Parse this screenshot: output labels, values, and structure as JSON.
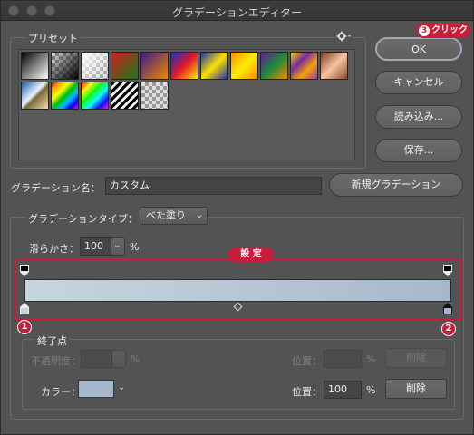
{
  "window": {
    "title": "グラデーションエディター"
  },
  "presets": {
    "label": "プリセット",
    "rows": [
      [
        "black-white",
        "transparent-black",
        "white-transparent",
        "red-green",
        "purple-orange",
        "blue-red-yellow",
        "blue-yellow-blue",
        "orange-yellow-orange",
        "violet-green-orange",
        "yellow-violet-orange",
        "copper"
      ],
      [
        "chrome",
        "spectrum",
        "transparent-rainbow",
        "transparent-stripes",
        "transparent"
      ]
    ]
  },
  "buttons": {
    "ok": "OK",
    "cancel": "キャンセル",
    "load": "読み込み...",
    "save": "保存...",
    "new_gradient": "新規グラデーション",
    "delete_opacity": "削除",
    "delete_color": "削除"
  },
  "callouts": {
    "click": "クリック",
    "click_num": "3",
    "setting": "設 定",
    "stop1_num": "1",
    "stop2_num": "2"
  },
  "name_field": {
    "label": "グラデーション名：",
    "value": "カスタム"
  },
  "gradient_type": {
    "label": "グラデーションタイプ：",
    "value": "べた塗り"
  },
  "smoothness": {
    "label": "滑らかさ：",
    "value": "100",
    "unit": "%"
  },
  "stops": {
    "label": "終了点",
    "opacity_label": "不透明度：",
    "opacity_unit": "%",
    "opacity_location_label": "位置：",
    "opacity_location_unit": "%",
    "color_label": "カラー：",
    "color_value": "#a7b8cc",
    "color_location_label": "位置：",
    "color_location_value": "100",
    "color_location_unit": "%"
  },
  "colors": {
    "gradient_start": "#c6d6df",
    "gradient_end": "#a7b8cc",
    "accent_red": "#c81e3a"
  },
  "icons": {
    "gear": "gear-icon",
    "chevron": "chevron-down-icon"
  }
}
